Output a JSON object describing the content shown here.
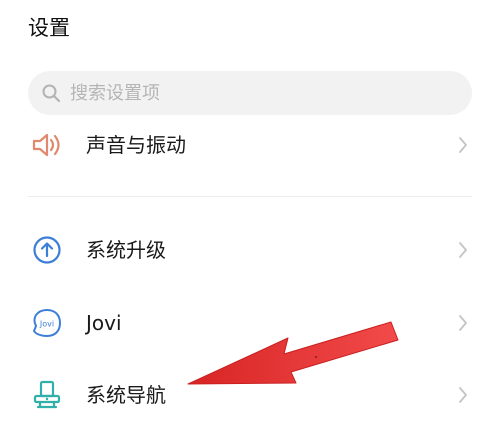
{
  "header": {
    "title": "设置"
  },
  "search": {
    "placeholder": "搜索设置项"
  },
  "items": [
    {
      "label": "声音与振动",
      "icon": "speaker-icon"
    },
    {
      "label": "系统升级",
      "icon": "upgrade-icon"
    },
    {
      "label": "Jovi",
      "icon": "jovi-icon"
    },
    {
      "label": "系统导航",
      "icon": "navigation-icon"
    }
  ],
  "colors": {
    "accent": "#3d7fd6",
    "sound_icon": "#e0896e",
    "chevron": "#c4c4c4",
    "annotation_arrow": "#ee3b3b"
  }
}
